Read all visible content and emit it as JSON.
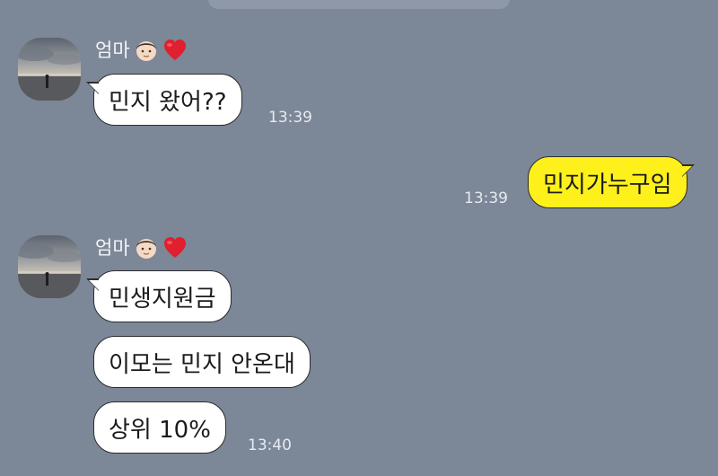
{
  "chat": {
    "groups": [
      {
        "sender": {
          "name": "엄마",
          "emojis": [
            "boy-face-icon",
            "red-heart-icon"
          ]
        },
        "messages": [
          {
            "text": "민지 왔어??",
            "time": "13:39"
          }
        ]
      },
      {
        "outgoing": [
          {
            "text": "민지가누구임",
            "time": "13:39"
          }
        ]
      },
      {
        "sender": {
          "name": "엄마",
          "emojis": [
            "boy-face-icon",
            "red-heart-icon"
          ]
        },
        "messages": [
          {
            "text": "민생지원금"
          },
          {
            "text": "이모는 민지 안온대"
          },
          {
            "text": "상위 10%",
            "time": "13:40"
          }
        ]
      }
    ]
  },
  "colors": {
    "background": "#7c8798",
    "incoming_bubble": "#ffffff",
    "outgoing_bubble": "#fef01b",
    "bubble_border": "#2d2d2d",
    "time_text": "#e8ebf0",
    "sender_text": "#f3f5f8"
  }
}
